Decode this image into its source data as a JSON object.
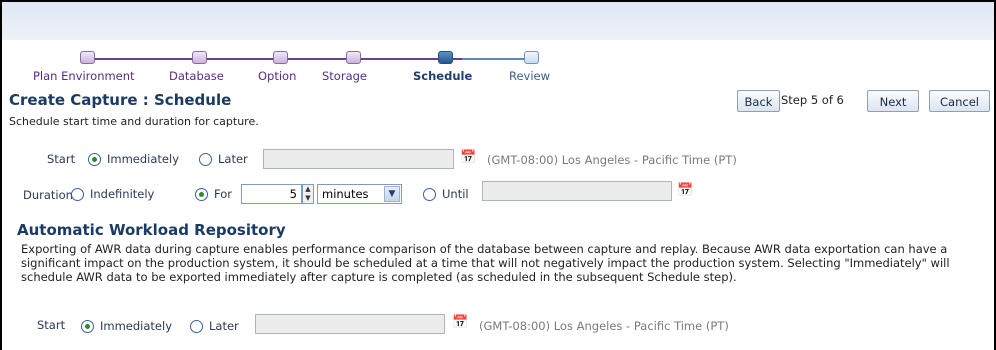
{
  "train": {
    "steps": [
      {
        "label": "Plan Environment",
        "state": "done"
      },
      {
        "label": "Database",
        "state": "done"
      },
      {
        "label": "Option",
        "state": "done"
      },
      {
        "label": "Storage",
        "state": "done"
      },
      {
        "label": "Schedule",
        "state": "current"
      },
      {
        "label": "Review",
        "state": "future"
      }
    ]
  },
  "page": {
    "title": "Create Capture : Schedule",
    "subtitle": "Schedule start time and duration for capture."
  },
  "nav": {
    "back_label": "Back",
    "step_text": "Step 5 of 6",
    "next_label": "Next",
    "cancel_label": "Cancel"
  },
  "capture": {
    "start_label": "Start",
    "start_options": [
      "Immediately",
      "Later"
    ],
    "start_selected": "Immediately",
    "start_later_value": "",
    "timezone": "(GMT-08:00) Los Angeles - Pacific Time (PT)",
    "duration_label": "Duration",
    "duration_options": [
      "Indefinitely",
      "For",
      "Until"
    ],
    "duration_selected": "For",
    "duration_value": "5",
    "duration_unit": "minutes",
    "until_value": ""
  },
  "awr": {
    "title": "Automatic Workload Repository",
    "description": "Exporting of AWR data during capture enables performance comparison of the database between capture and replay. Because AWR data exportation can have a significant impact on the production system, it should be scheduled at a time that will not negatively impact the production system. Selecting \"Immediately\" will schedule AWR data to be exported immediately after capture is completed (as scheduled in the subsequent Schedule step).",
    "start_label": "Start",
    "start_options": [
      "Immediately",
      "Later"
    ],
    "start_selected": "Immediately",
    "start_later_value": "",
    "timezone": "(GMT-08:00) Los Angeles - Pacific Time (PT)"
  },
  "colors": {
    "train_done": "#6b3f8d",
    "train_current": "#23568e",
    "heading": "#1b3a64"
  }
}
